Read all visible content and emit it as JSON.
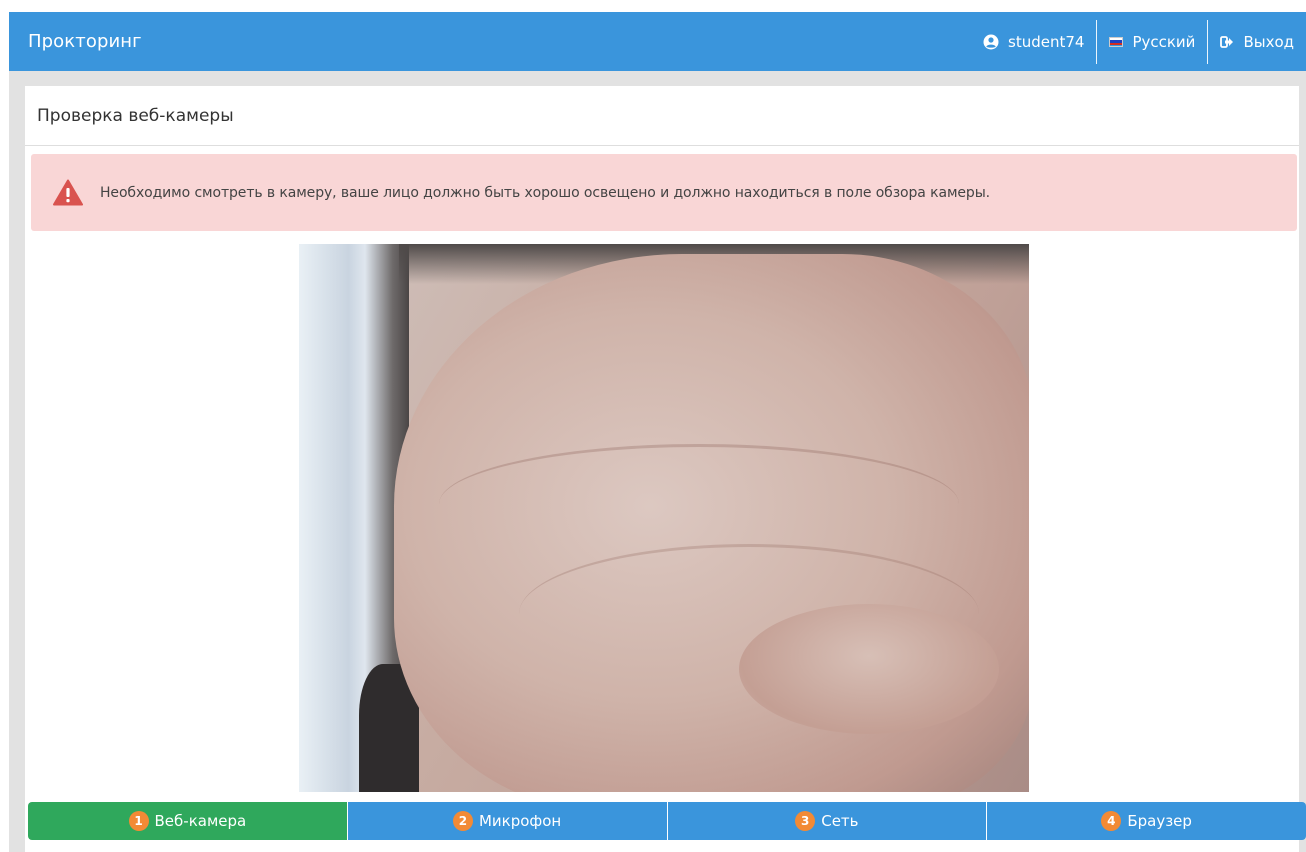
{
  "navbar": {
    "brand": "Прокторинг",
    "user": "student74",
    "language": "Русский",
    "logout": "Выход"
  },
  "panel": {
    "title": "Проверка веб-камеры",
    "alert_text": "Необходимо смотреть в камеру, ваше лицо должно быть хорошо освещено и должно находиться в поле обзора камеры."
  },
  "steps": [
    {
      "number": "1",
      "label": "Веб-камера",
      "active": true
    },
    {
      "number": "2",
      "label": "Микрофон",
      "active": false
    },
    {
      "number": "3",
      "label": "Сеть",
      "active": false
    },
    {
      "number": "4",
      "label": "Браузер",
      "active": false
    }
  ],
  "colors": {
    "navbar": "#3a95dc",
    "step_active": "#2fa85c",
    "step_inactive": "#3a95dc",
    "badge": "#f28a35",
    "alert_bg": "#f9d6d6",
    "alert_icon": "#d9534f"
  },
  "icons": {
    "user": "user-circle-icon",
    "language": "russian-flag-icon",
    "logout": "sign-out-icon",
    "alert": "warning-triangle-icon"
  }
}
